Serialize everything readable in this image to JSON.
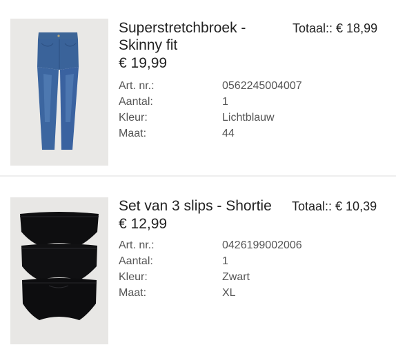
{
  "items": [
    {
      "title": "Superstretchbroek - Skinny fit",
      "price": "€ 19,99",
      "total": "Totaal:: € 18,99",
      "details": [
        {
          "label": "Art. nr.:",
          "value": "0562245004007"
        },
        {
          "label": "Aantal:",
          "value": "1"
        },
        {
          "label": "Kleur:",
          "value": "Lichtblauw"
        },
        {
          "label": "Maat:",
          "value": "44"
        }
      ],
      "image_icon": "jeans-product-image"
    },
    {
      "title": "Set van 3 slips - Shortie",
      "price": "€ 12,99",
      "total": "Totaal:: € 10,39",
      "details": [
        {
          "label": "Art. nr.:",
          "value": "0426199002006"
        },
        {
          "label": "Aantal:",
          "value": "1"
        },
        {
          "label": "Kleur:",
          "value": "Zwart"
        },
        {
          "label": "Maat:",
          "value": "XL"
        }
      ],
      "image_icon": "briefs-product-image"
    }
  ]
}
